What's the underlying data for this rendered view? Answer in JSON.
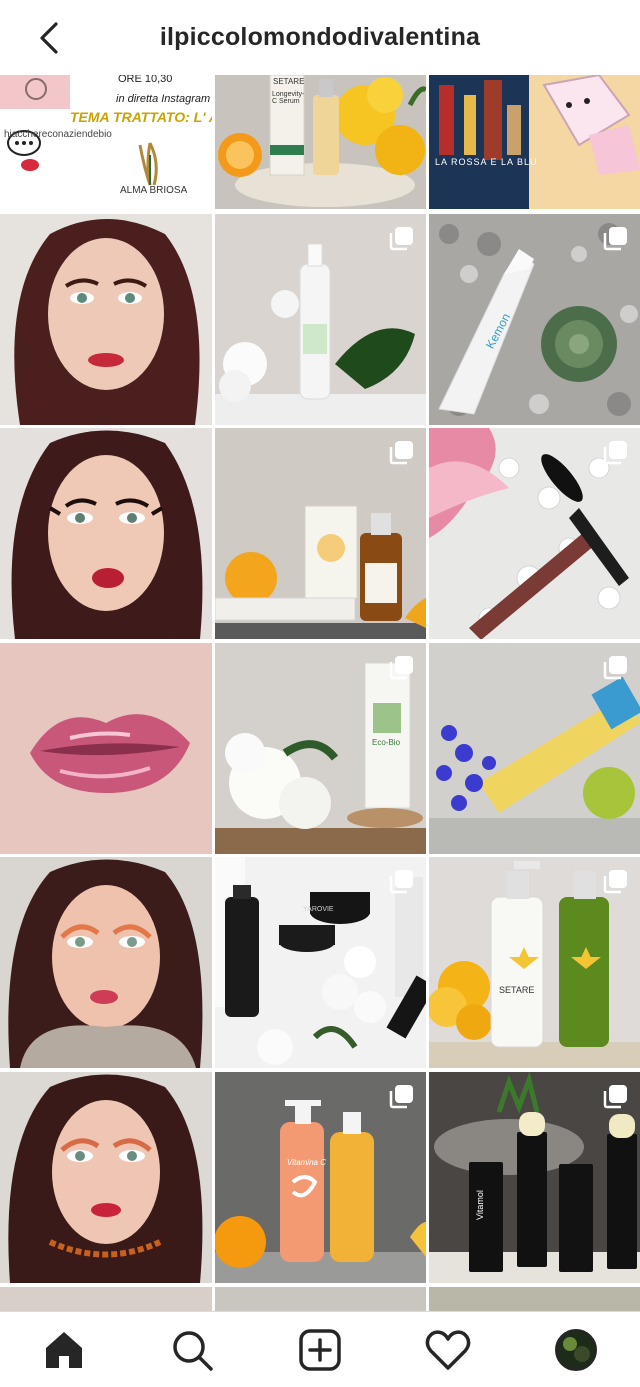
{
  "header": {
    "username": "ilpiccolomondodivalentina",
    "back_icon": "chevron-left-icon"
  },
  "tiles": [
    {
      "kind": "event-poster",
      "lines": [
        "ORE 10,30",
        "in diretta Instagram",
        "TEMA TRATTATO: L' AMBR",
        "hiacchereconaziendebio",
        "ALMA BRIOSA"
      ],
      "multi": false
    },
    {
      "kind": "product",
      "label": "SETARE",
      "sublabel": "Longevity-C Serum",
      "multi": false
    },
    {
      "kind": "book",
      "label": "LA ROSSA E LA BLU",
      "multi": false
    },
    {
      "kind": "portrait",
      "multi": false
    },
    {
      "kind": "product",
      "multi": true
    },
    {
      "kind": "product",
      "label": "Kemon",
      "multi": true
    },
    {
      "kind": "portrait",
      "multi": false
    },
    {
      "kind": "product",
      "multi": true
    },
    {
      "kind": "product",
      "multi": true
    },
    {
      "kind": "lips",
      "multi": false
    },
    {
      "kind": "product",
      "label": "Eco-Bio",
      "multi": true
    },
    {
      "kind": "product",
      "multi": true
    },
    {
      "kind": "portrait",
      "multi": false
    },
    {
      "kind": "product",
      "label": "YAROVIE",
      "multi": true
    },
    {
      "kind": "product",
      "label": "SETARE",
      "multi": true
    },
    {
      "kind": "portrait",
      "multi": false
    },
    {
      "kind": "product",
      "label": "Vitamina C",
      "multi": true
    },
    {
      "kind": "product",
      "label": "Vitamol",
      "multi": true
    }
  ],
  "nav": {
    "items": [
      "home-icon",
      "search-icon",
      "new-post-icon",
      "activity-heart-icon",
      "profile-avatar"
    ]
  },
  "colors": {
    "text": "#262626",
    "divider": "#dbdbdb",
    "lips": "#c62a3a"
  }
}
